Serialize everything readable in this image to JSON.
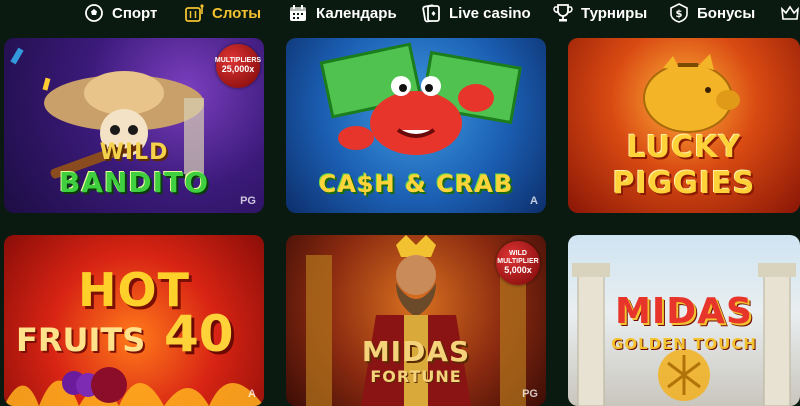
{
  "nav": {
    "items": [
      {
        "label": "Спорт",
        "icon": "soccer-ball-icon",
        "active": false
      },
      {
        "label": "Слоты",
        "icon": "slot-machine-icon",
        "active": true
      },
      {
        "label": "Календарь",
        "icon": "calendar-icon",
        "active": false
      },
      {
        "label": "Live casino",
        "icon": "cards-icon",
        "active": false
      },
      {
        "label": "Турниры",
        "icon": "trophy-icon",
        "active": false
      },
      {
        "label": "Бонусы",
        "icon": "dollar-icon",
        "active": false
      }
    ],
    "accent": "#f2c230"
  },
  "games": [
    {
      "title_line1": "WILD",
      "title_line2": "BANDITO",
      "badge_top": "MULTIPLIERS",
      "badge_value": "25,000x",
      "provider": "PG"
    },
    {
      "title_line1": "CA$H & CRAB",
      "provider": "A"
    },
    {
      "title_line1": "LUCKY",
      "title_line2": "PIGGIES"
    },
    {
      "title_line1": "HOT",
      "title_line2": "FRUITS",
      "title_num": "40",
      "provider": "A"
    },
    {
      "title_line1": "MIDAS",
      "title_line2": "FORTUNE",
      "badge_top": "WILD MULTIPLIER",
      "badge_value": "5,000x",
      "provider": "PG"
    },
    {
      "title_line1": "MIDAS",
      "title_line2": "GOLDEN TOUCH"
    }
  ]
}
